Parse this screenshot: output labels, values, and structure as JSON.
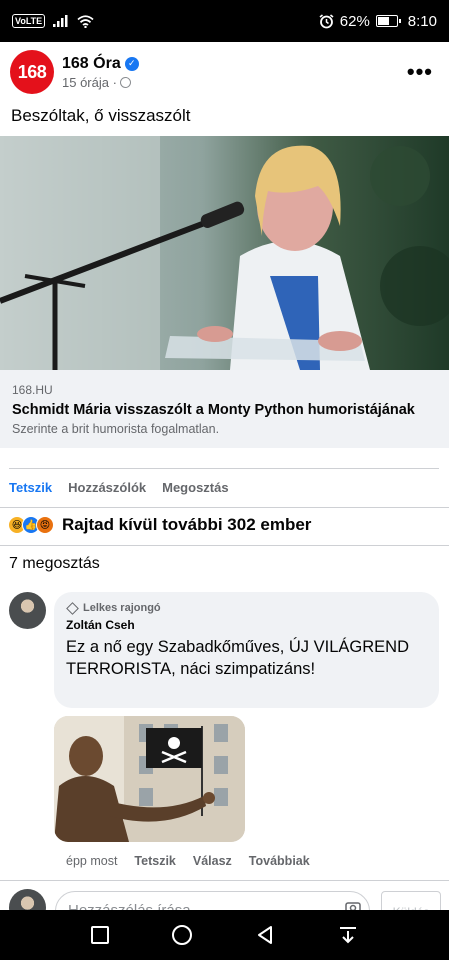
{
  "status_bar": {
    "volte": "VoLTE",
    "battery": "62%",
    "time": "8:10",
    "battery_level": 0.62
  },
  "post": {
    "page_logo": "168",
    "page_name": "168 Óra",
    "time": "15 órája ·",
    "text": "Beszóltak, ő visszaszólt",
    "link": {
      "domain": "168.HU",
      "title": "Schmidt Mária visszaszólt a Monty Python humoristájának",
      "description": "Szerinte a brit humorista fogalmatlan."
    },
    "actions": {
      "like": "Tetszik",
      "comments": "Hozzászólók",
      "share": "Megosztás"
    },
    "reactions_text": "Rajtad kívül további 302 ember",
    "shares_text": "7 megosztás"
  },
  "comment": {
    "badge": "Lelkes rajongó",
    "author": "Zoltán Cseh",
    "text": "Ez a nő egy Szabadkőműves, ÚJ VILÁGREND TERRORISTA, náci szimpatizáns!",
    "actions": {
      "time": "épp most",
      "like": "Tetszik",
      "reply": "Válasz",
      "more": "Továbbiak"
    }
  },
  "composer": {
    "placeholder": "Hozzászólás írása...",
    "send": "Küldés"
  },
  "icons": [
    "signal-icon",
    "wifi-icon",
    "alarm-icon",
    "battery-icon",
    "verified-icon",
    "globe-icon",
    "more-icon",
    "haha-reaction-icon",
    "like-reaction-icon",
    "angry-reaction-icon",
    "diamond-icon",
    "camera-icon",
    "nav-square-icon",
    "nav-home-icon",
    "nav-back-icon",
    "nav-down-icon"
  ],
  "colors": {
    "brand_red": "#e4111b",
    "facebook_blue": "#1877f2",
    "secondary_text": "#65676b",
    "bubble_bg": "#f0f2f5"
  }
}
